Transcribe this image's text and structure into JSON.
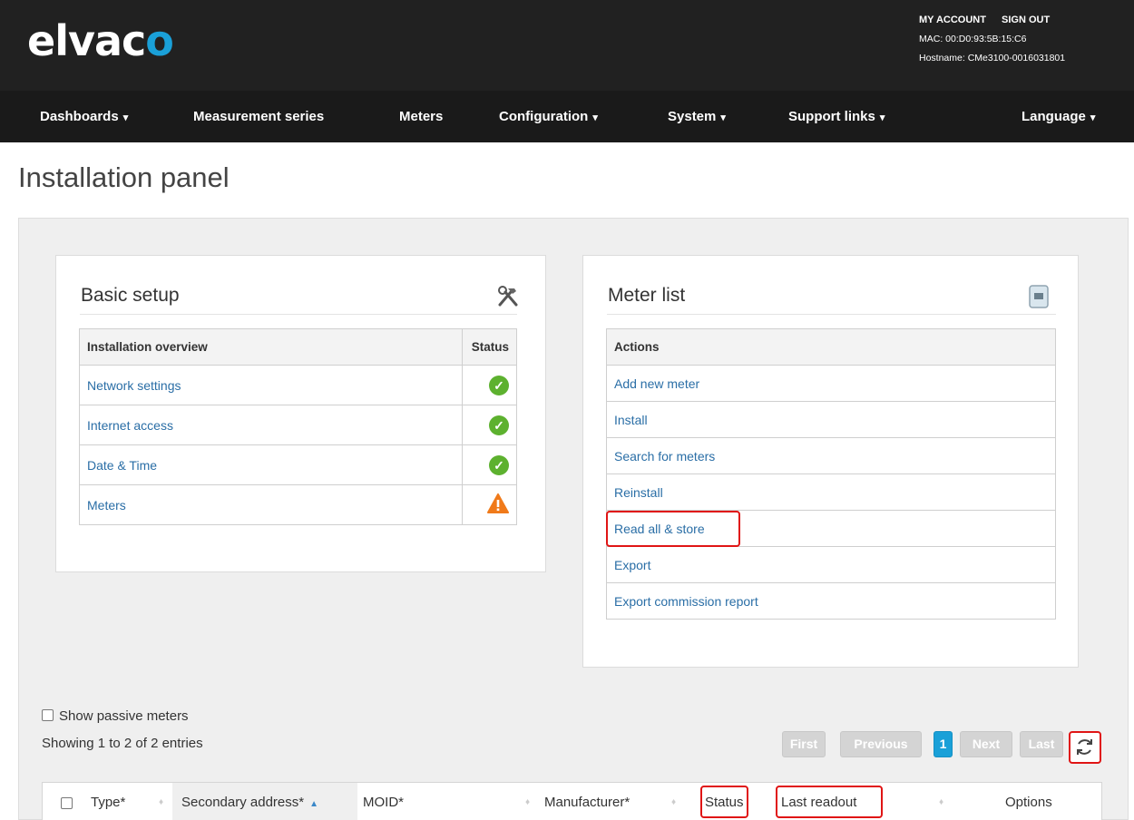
{
  "header": {
    "logo_main": "elvac",
    "logo_accent": "o",
    "my_account": "MY ACCOUNT",
    "sign_out": "SIGN OUT",
    "mac": "MAC: 00:D0:93:5B:15:C6",
    "hostname": "Hostname: CMe3100-0016031801"
  },
  "nav": {
    "dashboards": "Dashboards",
    "measurement_series": "Measurement series",
    "meters": "Meters",
    "configuration": "Configuration",
    "system": "System",
    "support_links": "Support links",
    "language": "Language",
    "caret": "▾"
  },
  "page": {
    "title": "Installation panel"
  },
  "basic_setup": {
    "title": "Basic setup",
    "icon": "tools-icon",
    "col_overview": "Installation overview",
    "col_status": "Status",
    "rows": [
      {
        "label": "Network settings",
        "status": "ok"
      },
      {
        "label": "Internet access",
        "status": "ok"
      },
      {
        "label": "Date & Time",
        "status": "ok"
      },
      {
        "label": "Meters",
        "status": "warning"
      }
    ]
  },
  "meter_list": {
    "title": "Meter list",
    "icon": "meter-icon",
    "col_actions": "Actions",
    "actions": [
      "Add new meter",
      "Install",
      "Search for meters",
      "Reinstall",
      "Read all & store",
      "Export",
      "Export commission report"
    ]
  },
  "table_controls": {
    "show_passive": "Show passive meters",
    "showing": "Showing 1 to 2 of 2 entries",
    "pagination": {
      "first": "First",
      "previous": "Previous",
      "current": "1",
      "next": "Next",
      "last": "Last"
    }
  },
  "grid": {
    "columns": {
      "type": "Type*",
      "secondary_address": "Secondary address*",
      "moid": "MOID*",
      "manufacturer": "Manufacturer*",
      "status": "Status",
      "last_readout": "Last readout",
      "options": "Options"
    }
  },
  "colors": {
    "header_bg": "#212121",
    "brand_blue": "#1aa0d8",
    "ok_green": "#5db12f",
    "warning_orange": "#f07a1a",
    "highlight_red": "#e01515",
    "link_blue": "#2a6ea6"
  }
}
